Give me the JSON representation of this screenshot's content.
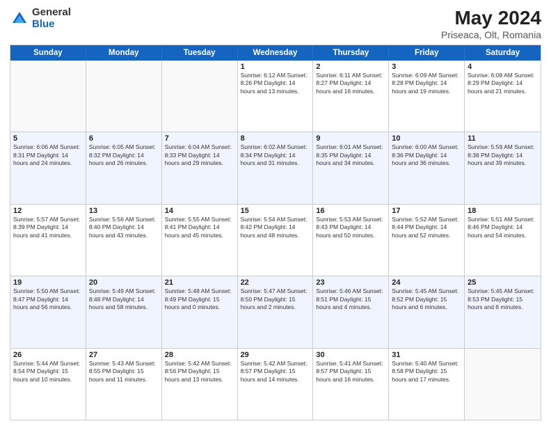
{
  "logo": {
    "general": "General",
    "blue": "Blue"
  },
  "title": "May 2024",
  "location": "Priseaca, Olt, Romania",
  "days_of_week": [
    "Sunday",
    "Monday",
    "Tuesday",
    "Wednesday",
    "Thursday",
    "Friday",
    "Saturday"
  ],
  "weeks": [
    {
      "alt": false,
      "cells": [
        {
          "day": "",
          "info": ""
        },
        {
          "day": "",
          "info": ""
        },
        {
          "day": "",
          "info": ""
        },
        {
          "day": "1",
          "info": "Sunrise: 6:12 AM\nSunset: 8:26 PM\nDaylight: 14 hours\nand 13 minutes."
        },
        {
          "day": "2",
          "info": "Sunrise: 6:11 AM\nSunset: 8:27 PM\nDaylight: 14 hours\nand 16 minutes."
        },
        {
          "day": "3",
          "info": "Sunrise: 6:09 AM\nSunset: 8:28 PM\nDaylight: 14 hours\nand 19 minutes."
        },
        {
          "day": "4",
          "info": "Sunrise: 6:08 AM\nSunset: 8:29 PM\nDaylight: 14 hours\nand 21 minutes."
        }
      ]
    },
    {
      "alt": true,
      "cells": [
        {
          "day": "5",
          "info": "Sunrise: 6:06 AM\nSunset: 8:31 PM\nDaylight: 14 hours\nand 24 minutes."
        },
        {
          "day": "6",
          "info": "Sunrise: 6:05 AM\nSunset: 8:32 PM\nDaylight: 14 hours\nand 26 minutes."
        },
        {
          "day": "7",
          "info": "Sunrise: 6:04 AM\nSunset: 8:33 PM\nDaylight: 14 hours\nand 29 minutes."
        },
        {
          "day": "8",
          "info": "Sunrise: 6:02 AM\nSunset: 8:34 PM\nDaylight: 14 hours\nand 31 minutes."
        },
        {
          "day": "9",
          "info": "Sunrise: 6:01 AM\nSunset: 8:35 PM\nDaylight: 14 hours\nand 34 minutes."
        },
        {
          "day": "10",
          "info": "Sunrise: 6:00 AM\nSunset: 8:36 PM\nDaylight: 14 hours\nand 36 minutes."
        },
        {
          "day": "11",
          "info": "Sunrise: 5:59 AM\nSunset: 8:38 PM\nDaylight: 14 hours\nand 39 minutes."
        }
      ]
    },
    {
      "alt": false,
      "cells": [
        {
          "day": "12",
          "info": "Sunrise: 5:57 AM\nSunset: 8:39 PM\nDaylight: 14 hours\nand 41 minutes."
        },
        {
          "day": "13",
          "info": "Sunrise: 5:56 AM\nSunset: 8:40 PM\nDaylight: 14 hours\nand 43 minutes."
        },
        {
          "day": "14",
          "info": "Sunrise: 5:55 AM\nSunset: 8:41 PM\nDaylight: 14 hours\nand 45 minutes."
        },
        {
          "day": "15",
          "info": "Sunrise: 5:54 AM\nSunset: 8:42 PM\nDaylight: 14 hours\nand 48 minutes."
        },
        {
          "day": "16",
          "info": "Sunrise: 5:53 AM\nSunset: 8:43 PM\nDaylight: 14 hours\nand 50 minutes."
        },
        {
          "day": "17",
          "info": "Sunrise: 5:52 AM\nSunset: 8:44 PM\nDaylight: 14 hours\nand 52 minutes."
        },
        {
          "day": "18",
          "info": "Sunrise: 5:51 AM\nSunset: 8:46 PM\nDaylight: 14 hours\nand 54 minutes."
        }
      ]
    },
    {
      "alt": true,
      "cells": [
        {
          "day": "19",
          "info": "Sunrise: 5:50 AM\nSunset: 8:47 PM\nDaylight: 14 hours\nand 56 minutes."
        },
        {
          "day": "20",
          "info": "Sunrise: 5:49 AM\nSunset: 8:48 PM\nDaylight: 14 hours\nand 58 minutes."
        },
        {
          "day": "21",
          "info": "Sunrise: 5:48 AM\nSunset: 8:49 PM\nDaylight: 15 hours\nand 0 minutes."
        },
        {
          "day": "22",
          "info": "Sunrise: 5:47 AM\nSunset: 8:50 PM\nDaylight: 15 hours\nand 2 minutes."
        },
        {
          "day": "23",
          "info": "Sunrise: 5:46 AM\nSunset: 8:51 PM\nDaylight: 15 hours\nand 4 minutes."
        },
        {
          "day": "24",
          "info": "Sunrise: 5:45 AM\nSunset: 8:52 PM\nDaylight: 15 hours\nand 6 minutes."
        },
        {
          "day": "25",
          "info": "Sunrise: 5:45 AM\nSunset: 8:53 PM\nDaylight: 15 hours\nand 8 minutes."
        }
      ]
    },
    {
      "alt": false,
      "cells": [
        {
          "day": "26",
          "info": "Sunrise: 5:44 AM\nSunset: 8:54 PM\nDaylight: 15 hours\nand 10 minutes."
        },
        {
          "day": "27",
          "info": "Sunrise: 5:43 AM\nSunset: 8:55 PM\nDaylight: 15 hours\nand 11 minutes."
        },
        {
          "day": "28",
          "info": "Sunrise: 5:42 AM\nSunset: 8:56 PM\nDaylight: 15 hours\nand 13 minutes."
        },
        {
          "day": "29",
          "info": "Sunrise: 5:42 AM\nSunset: 8:57 PM\nDaylight: 15 hours\nand 14 minutes."
        },
        {
          "day": "30",
          "info": "Sunrise: 5:41 AM\nSunset: 8:57 PM\nDaylight: 15 hours\nand 16 minutes."
        },
        {
          "day": "31",
          "info": "Sunrise: 5:40 AM\nSunset: 8:58 PM\nDaylight: 15 hours\nand 17 minutes."
        },
        {
          "day": "",
          "info": ""
        }
      ]
    }
  ]
}
